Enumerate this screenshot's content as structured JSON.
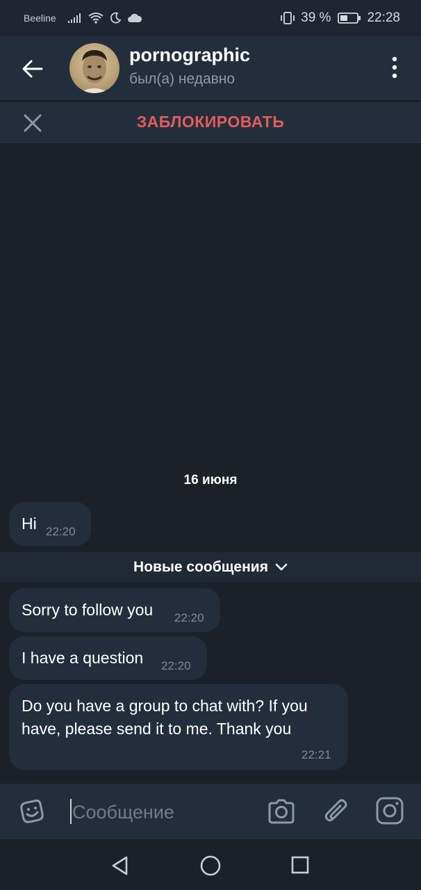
{
  "status_bar": {
    "carrier": "Beeline",
    "battery_percent": "39 %",
    "time": "22:28"
  },
  "header": {
    "title": "pornographic",
    "subtitle": "был(а) недавно"
  },
  "block_bar": {
    "block_label": "ЗАБЛОКИРОВАТЬ"
  },
  "chat": {
    "date_separator": "16 июня",
    "messages_before": [
      {
        "text": "Hi",
        "time": "22:20"
      }
    ],
    "new_messages_label": "Новые сообщения",
    "messages_after": [
      {
        "text": "Sorry to follow you",
        "time": "22:20"
      },
      {
        "text": "I have a question",
        "time": "22:20"
      },
      {
        "text_lines": [
          "Do you have a group to chat with? If you",
          "have, please send it to me. Thank you"
        ],
        "time": "22:21"
      }
    ]
  },
  "input_bar": {
    "placeholder": "Сообщение"
  },
  "colors": {
    "background": "#1b2029",
    "panel": "#232e3c",
    "accent_red": "#e35c5c",
    "muted_text": "#8d9aa8"
  },
  "icons": {
    "back": "arrow-left-icon",
    "menu": "three-dots-vertical-icon",
    "close": "close-icon",
    "emoji": "sticker-smile-icon",
    "camera": "camera-icon",
    "attach": "paperclip-icon",
    "instagram": "instagram-icon"
  }
}
